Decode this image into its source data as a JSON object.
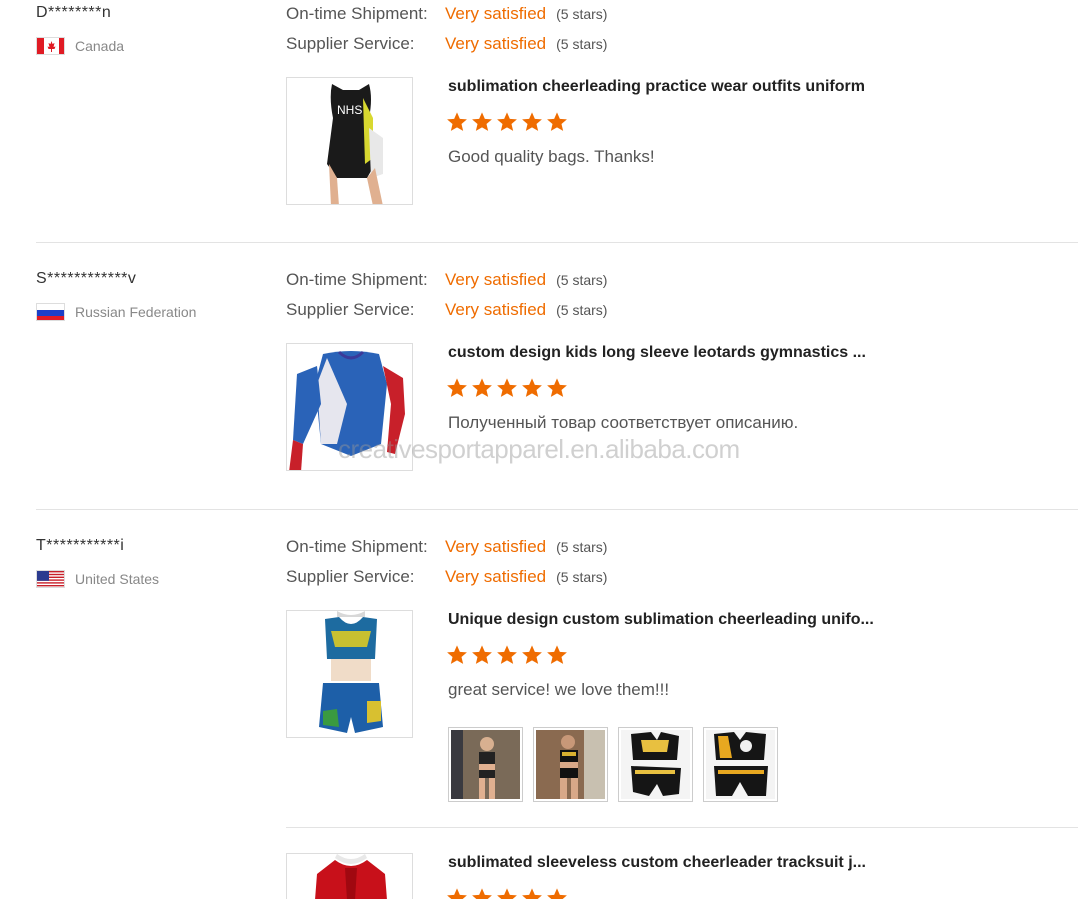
{
  "colors": {
    "accent": "#ef6c00",
    "star": "#ef6c00",
    "divider": "#e3e3e3"
  },
  "watermark": "creativesportapparel.en.alibaba.com",
  "reviews": [
    {
      "buyer": "D********n",
      "country": "Canada",
      "flag_icon": "canada-flag-icon",
      "shipment_label": "On-time Shipment:",
      "shipment_value": "Very satisfied",
      "shipment_stars": "(5 stars)",
      "service_label": "Supplier Service:",
      "service_value": "Very satisfied",
      "service_stars": "(5 stars)",
      "product_title": "sublimation cheerleading practice wear outfits uniform",
      "rating": 5,
      "comment": "Good quality bags. Thanks!"
    },
    {
      "buyer": "S************v",
      "country": "Russian Federation",
      "flag_icon": "russia-flag-icon",
      "shipment_label": "On-time Shipment:",
      "shipment_value": "Very satisfied",
      "shipment_stars": "(5 stars)",
      "service_label": "Supplier Service:",
      "service_value": "Very satisfied",
      "service_stars": "(5 stars)",
      "product_title": "custom design kids long sleeve leotards gymnastics ...",
      "rating": 5,
      "comment": "Полученный товар соответствует описанию."
    },
    {
      "buyer": "T***********i",
      "country": "United States",
      "flag_icon": "usa-flag-icon",
      "shipment_label": "On-time Shipment:",
      "shipment_value": "Very satisfied",
      "shipment_stars": "(5 stars)",
      "service_label": "Supplier Service:",
      "service_value": "Very satisfied",
      "service_stars": "(5 stars)",
      "product_title": "Unique design custom sublimation cheerleading unifo...",
      "rating": 5,
      "comment": "great service! we love them!!!",
      "photo_count": 4,
      "second_product_title": "sublimated sleeveless custom cheerleader tracksuit j...",
      "second_rating": 5
    }
  ]
}
